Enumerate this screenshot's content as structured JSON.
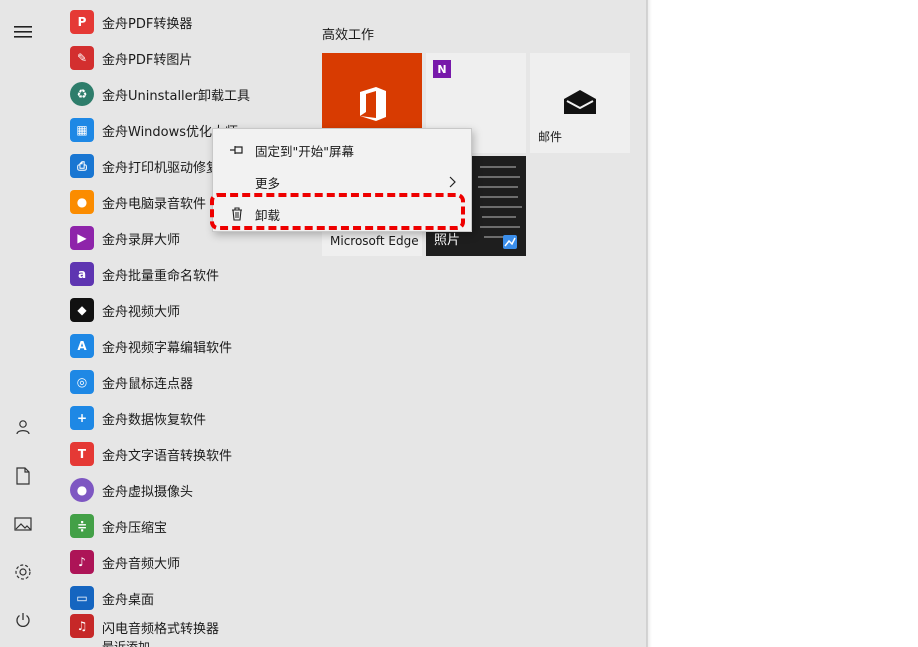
{
  "rail": {
    "icons": [
      "menu-icon",
      "user-icon",
      "document-icon",
      "pictures-icon",
      "settings-icon",
      "power-icon"
    ]
  },
  "apps": [
    {
      "label": "金舟PDF转换器",
      "icon": "pdf-converter-icon",
      "color": "#e53935"
    },
    {
      "label": "金舟PDF转图片",
      "icon": "pdf-to-image-icon",
      "color": "#d32f2f"
    },
    {
      "label": "金舟Uninstaller卸载工具",
      "icon": "uninstaller-icon",
      "color": "#2e7d6b"
    },
    {
      "label": "金舟Windows优化大师",
      "icon": "windows-optimizer-icon",
      "color": "#1e88e5"
    },
    {
      "label": "金舟打印机驱动修复",
      "icon": "printer-driver-icon",
      "color": "#1976d2"
    },
    {
      "label": "金舟电脑录音软件",
      "icon": "microphone-icon",
      "color": "#fb8c00"
    },
    {
      "label": "金舟录屏大师",
      "icon": "screen-recorder-icon",
      "color": "#8e24aa"
    },
    {
      "label": "金舟批量重命名软件",
      "icon": "rename-icon",
      "color": "#5e35b1"
    },
    {
      "label": "金舟视频大师",
      "icon": "video-master-icon",
      "color": "#111111"
    },
    {
      "label": "金舟视频字幕编辑软件",
      "icon": "subtitle-editor-icon",
      "color": "#1e88e5"
    },
    {
      "label": "金舟鼠标连点器",
      "icon": "mouse-clicker-icon",
      "color": "#1e88e5"
    },
    {
      "label": "金舟数据恢复软件",
      "icon": "data-recovery-icon",
      "color": "#1e88e5"
    },
    {
      "label": "金舟文字语音转换软件",
      "icon": "text-to-speech-icon",
      "color": "#e53935"
    },
    {
      "label": "金舟虚拟摄像头",
      "icon": "virtual-camera-icon",
      "color": "#7e57c2"
    },
    {
      "label": "金舟压缩宝",
      "icon": "compress-icon",
      "color": "#43a047"
    },
    {
      "label": "金舟音频大师",
      "icon": "audio-master-icon",
      "color": "#ad1457"
    },
    {
      "label": "金舟桌面",
      "icon": "desktop-icon",
      "color": "#1565c0"
    },
    {
      "label": "闪电音频格式转换器",
      "icon": "audio-converter-icon",
      "color": "#c62828",
      "sub": "最近添加"
    }
  ],
  "tiles": {
    "group_title": "高效工作",
    "mail_label": "邮件",
    "edge_label": "Microsoft Edge",
    "photos_label": "照片"
  },
  "context_menu": {
    "pin_label": "固定到\"开始\"屏幕",
    "more_label": "更多",
    "uninstall_label": "卸载"
  },
  "colors": {
    "highlight": "#ee0000",
    "office": "#d83b01",
    "panel": "#e6e6e6"
  }
}
